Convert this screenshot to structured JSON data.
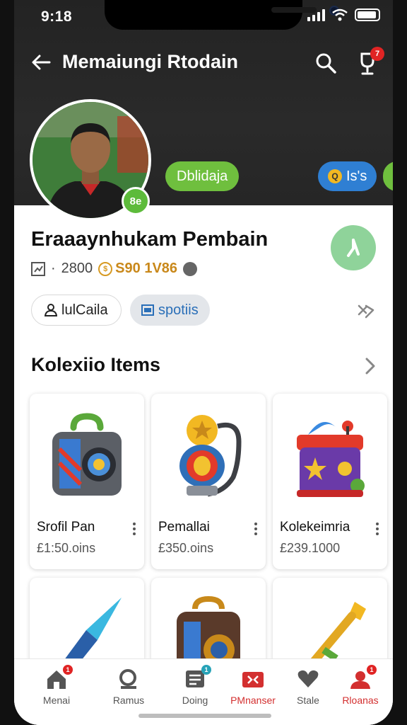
{
  "status": {
    "time": "9:18"
  },
  "header": {
    "title": "Memaiungi Rtodain",
    "notification_count": "7",
    "avatar_badge": "8e",
    "pill_green": "Dblidaja",
    "pill_blue": "Is's",
    "pill_blue_coin": "Q"
  },
  "profile": {
    "name": "Eraaaynhukam Pembain",
    "stat_count": "2800",
    "stat_gold": "S90 1V86",
    "chip_follow": "lulCaila",
    "chip_sport": "spotiis"
  },
  "section": {
    "title": "Kolexiio Items"
  },
  "items": [
    {
      "name": "Srofil Pan",
      "price": "£1:50.oins"
    },
    {
      "name": "Pemallai",
      "price": "£350.oins"
    },
    {
      "name": "Kolekeimria",
      "price": "£239.1000"
    }
  ],
  "nav": [
    {
      "label": "Menai",
      "icon": "home-icon",
      "badge": "1"
    },
    {
      "label": "Ramus",
      "icon": "search-icon",
      "badge": ""
    },
    {
      "label": "Doing",
      "icon": "list-icon",
      "badge": "1"
    },
    {
      "label": "PMnanser",
      "icon": "media-icon",
      "badge": ""
    },
    {
      "label": "Stale",
      "icon": "heart-icon",
      "badge": ""
    },
    {
      "label": "Rloanas",
      "icon": "people-icon",
      "badge": "1"
    }
  ],
  "colors": {
    "accent_green": "#6fbf3e",
    "accent_blue": "#2f7fd3",
    "accent_red": "#d32f2f",
    "header_bg": "#262626"
  }
}
